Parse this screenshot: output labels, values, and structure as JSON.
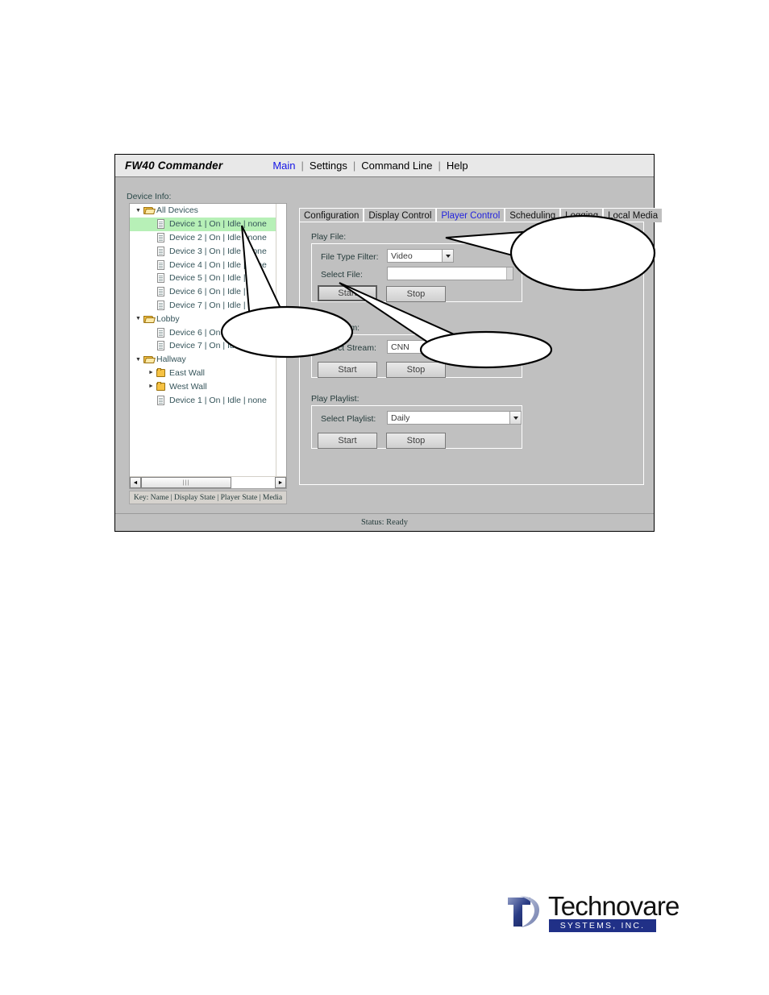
{
  "window": {
    "app_title": "FW40 Commander",
    "menu": [
      {
        "label": "Main",
        "active": true
      },
      {
        "label": "Settings",
        "active": false
      },
      {
        "label": "Command Line",
        "active": false
      },
      {
        "label": "Help",
        "active": false
      }
    ],
    "menu_separator": "|",
    "status": "Status: Ready"
  },
  "sidebar": {
    "label": "Device Info:",
    "key_bar": "Key: Name | Display State | Player State | Media",
    "tree": [
      {
        "depth": 0,
        "arrow": "▼",
        "icon": "folder-open-icon",
        "label": "All Devices",
        "selected": false
      },
      {
        "depth": 1,
        "arrow": "",
        "icon": "document-icon",
        "label": "Device 1 | On | Idle | none",
        "selected": true
      },
      {
        "depth": 1,
        "arrow": "",
        "icon": "document-icon",
        "label": "Device 2 | On | Idle | none",
        "selected": false
      },
      {
        "depth": 1,
        "arrow": "",
        "icon": "document-icon",
        "label": "Device 3 | On | Idle | none",
        "selected": false
      },
      {
        "depth": 1,
        "arrow": "",
        "icon": "document-icon",
        "label": "Device 4 | On | Idle | none",
        "selected": false
      },
      {
        "depth": 1,
        "arrow": "",
        "icon": "document-icon",
        "label": "Device 5 | On | Idle | none",
        "selected": false
      },
      {
        "depth": 1,
        "arrow": "",
        "icon": "document-icon",
        "label": "Device 6 | On | Idle | none",
        "selected": false
      },
      {
        "depth": 1,
        "arrow": "",
        "icon": "document-icon",
        "label": "Device 7 | On | Idle | none",
        "selected": false
      },
      {
        "depth": 0,
        "arrow": "▼",
        "icon": "folder-open-icon",
        "label": "Lobby",
        "selected": false
      },
      {
        "depth": 1,
        "arrow": "",
        "icon": "document-icon",
        "label": "Device 6 | On | Idle | none",
        "selected": false
      },
      {
        "depth": 1,
        "arrow": "",
        "icon": "document-icon",
        "label": "Device 7 | On | Idle | none",
        "selected": false
      },
      {
        "depth": 0,
        "arrow": "▼",
        "icon": "folder-open-icon",
        "label": "Hallway",
        "selected": false
      },
      {
        "depth": 1,
        "arrow": "►",
        "icon": "folder-icon",
        "label": "East Wall",
        "selected": false
      },
      {
        "depth": 1,
        "arrow": "►",
        "icon": "folder-icon",
        "label": "West Wall",
        "selected": false
      },
      {
        "depth": 1,
        "arrow": "",
        "icon": "document-icon",
        "label": "Device 1 | On | Idle | none",
        "selected": false
      }
    ],
    "hscroll_thumb_glyph": "|||",
    "scroll_left_glyph": "◄",
    "scroll_right_glyph": "►"
  },
  "tabs": [
    {
      "label": "Configuration",
      "active": false
    },
    {
      "label": "Display Control",
      "active": false
    },
    {
      "label": "Player Control",
      "active": true
    },
    {
      "label": "Scheduling",
      "active": false
    },
    {
      "label": "Logging",
      "active": false
    },
    {
      "label": "Local Media",
      "active": false
    }
  ],
  "player_control": {
    "play_file": {
      "title": "Play File:",
      "file_type_filter_label": "File Type Filter:",
      "file_type_filter_value": "Video",
      "select_file_label": "Select File:",
      "select_file_value": "",
      "start_label": "Start",
      "stop_label": "Stop"
    },
    "play_stream": {
      "title": "Play Stream:",
      "select_stream_label": "Select Stream:",
      "select_stream_value": "CNN",
      "start_label": "Start",
      "stop_label": "Stop"
    },
    "play_playlist": {
      "title": "Play Playlist:",
      "select_playlist_label": "Select Playlist:",
      "select_playlist_value": "Daily",
      "start_label": "Start",
      "stop_label": "Stop"
    }
  },
  "callouts": [
    {
      "id": "callout-1",
      "text": ""
    },
    {
      "id": "callout-2",
      "text": ""
    },
    {
      "id": "callout-3",
      "text": ""
    }
  ],
  "logo": {
    "name": "Technovare",
    "tagline": "SYSTEMS, INC."
  },
  "colors": {
    "accent_blue": "#1414e6",
    "tab_active": "#2222dd",
    "selection_green": "#b7f0b7",
    "window_face": "#c0c0c0",
    "logo_blue": "#203087"
  }
}
